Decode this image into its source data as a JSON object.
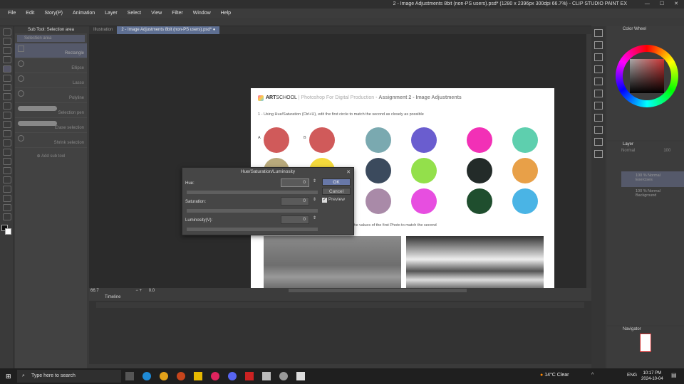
{
  "window": {
    "title": "2 - Image Adjustments 8bit (non-PS users).psd* (1280 x 2396px 300dpi 66.7%) - CLIP STUDIO PAINT EX"
  },
  "menu": [
    "File",
    "Edit",
    "Story(P)",
    "Animation",
    "Layer",
    "Select",
    "View",
    "Filter",
    "Window",
    "Help"
  ],
  "subtool": {
    "header": "Sub Tool: Selection area",
    "group": "Selection area",
    "items": [
      "Rectangle",
      "Ellipse",
      "Lasso",
      "Polyline",
      "Selection pen",
      "Erase selection",
      "Shrink selection"
    ],
    "add": "Add sub tool"
  },
  "tabs": [
    "Illustration",
    "2 - Image Adjustments 8bit (non-PS users).psd*"
  ],
  "document": {
    "brand_bold": "ART",
    "brand_rest": "SCHOOL",
    "course": "Photoshop For Digital Production",
    "assignment": "Assignment 2 - Image Adjustments",
    "instruction1": "1 - Using Hue/Saturation (Ctrl+U), edit the first circle to match the second as closely as possible",
    "label_a": "A",
    "label_b": "B",
    "instruction2": "the values of the first Photo to match the second",
    "circles": [
      [
        "#d05a5a",
        "#d05a5a",
        "#7aa9b0",
        "#6a5dcf",
        "#f230b6",
        "#5ecfae"
      ],
      [
        "#b9aa7c",
        "#f5da3c",
        "#3b4a5d",
        "#93e04b",
        "#232b29",
        "#e8a048"
      ],
      [
        null,
        null,
        "#a98aa8",
        "#e74ee0",
        "#1f4e2e",
        "#4ab4e5"
      ]
    ]
  },
  "dialog": {
    "title": "Hue/Saturation/Luminosity",
    "hue_label": "Hue:",
    "hue": "0",
    "sat_label": "Saturation:",
    "sat": "0",
    "lum_label": "Luminosity(V):",
    "lum": "0",
    "ok": "OK",
    "cancel": "Cancel",
    "preview": "Preview"
  },
  "status": {
    "zoom": "66.7",
    "angle": "0.0"
  },
  "timeline": {
    "title": "Timeline"
  },
  "right": {
    "color_wheel": "Color Wheel",
    "layer_tab": "Layer",
    "blend": "Normal",
    "opacity": "100",
    "layers": [
      {
        "mode": "100 % Normal",
        "name": "Exercises"
      },
      {
        "mode": "100 % Normal",
        "name": "Background"
      }
    ],
    "navigator": "Navigator"
  },
  "taskbar": {
    "search": "Type here to search",
    "weather": "14°C  Clear",
    "lang": "ENG",
    "time": "10:17 PM",
    "date": "2024-10-04"
  }
}
